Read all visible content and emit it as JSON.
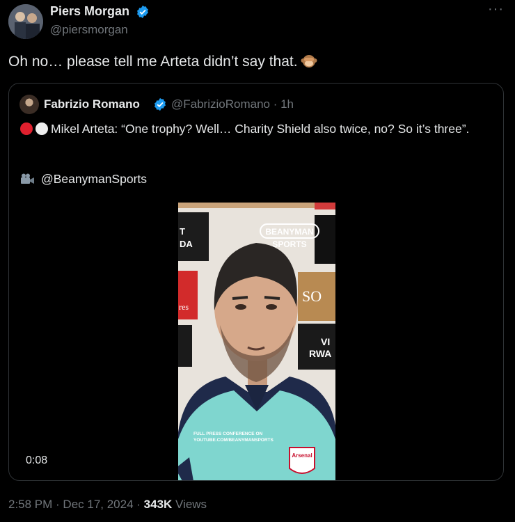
{
  "author": {
    "name": "Piers Morgan",
    "handle": "@piersmorgan",
    "verified_color": "#1d9bf0"
  },
  "more_icon": "more-dots-icon",
  "tweet_text": "Oh no… please tell me Arteta didn’t say that.",
  "tweet_emoji": "see-no-evil-monkey-icon",
  "quote": {
    "name": "Fabrizio Romano",
    "handle_time": "@FabrizioRomano · 1h",
    "text": "Mikel Arteta: “One trophy? Well… Charity Shield also twice, no? So it’s three”.",
    "credit": "@BeanymanSports",
    "credit_icon": "video-camera-icon",
    "video": {
      "duration": "0:08",
      "watermark_line1": "BEANYMAN",
      "watermark_line2": "SPORTS",
      "overlay_line1": "FULL PRESS CONFERENCE ON",
      "overlay_line2": "YOUTUBE.COM/BEANYMANSPORTS",
      "board_left_top": "T",
      "board_left_mid": "DA",
      "board_left_red": "res",
      "board_right_so": "SO",
      "board_right_vi": "VI",
      "board_right_rwa": "RWA",
      "badge": "Arsenal"
    }
  },
  "meta": {
    "time": "2:58 PM · Dec 17, 2024 · ",
    "views_count": "343K",
    "views_label": " Views"
  }
}
